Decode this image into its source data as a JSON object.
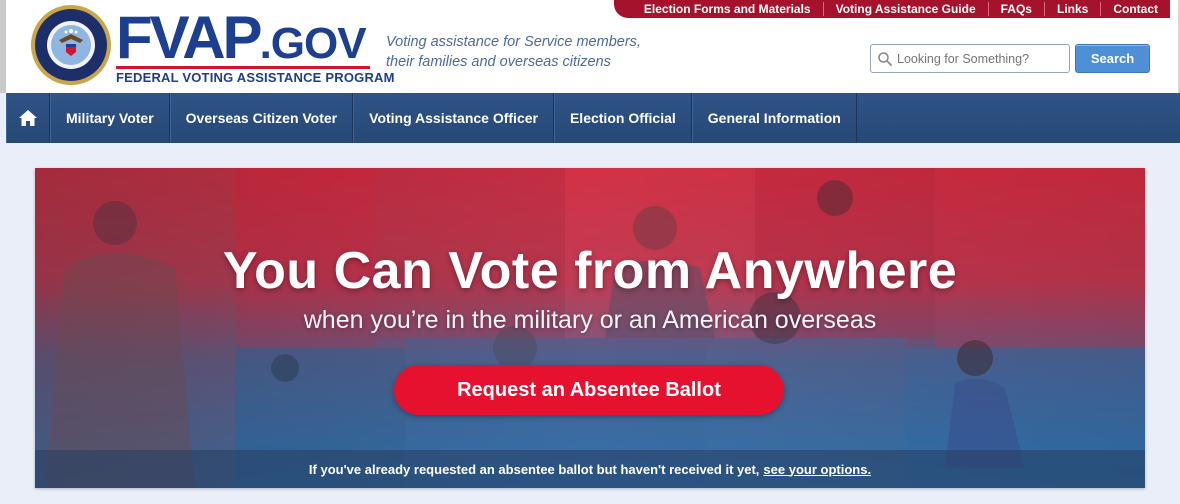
{
  "header": {
    "logo_main": "FVAP",
    "logo_gov": ".GOV",
    "logo_sub": "FEDERAL VOTING ASSISTANCE PROGRAM",
    "seal_alt": "DEPARTMENT OF DEFENSE",
    "tagline_line1": "Voting assistance for Service members,",
    "tagline_line2": "their families and overseas citizens"
  },
  "utility_links": [
    "Election Forms and Materials",
    "Voting Assistance Guide",
    "FAQs",
    "Links",
    "Contact"
  ],
  "search": {
    "placeholder": "Looking for Something?",
    "button_label": "Search"
  },
  "nav": {
    "home_icon": "home-icon",
    "items": [
      "Military Voter",
      "Overseas Citizen Voter",
      "Voting Assistance Officer",
      "Election Official",
      "General Information"
    ]
  },
  "hero": {
    "title": "You Can Vote from Anywhere",
    "subtitle": "when you’re in the military or an American overseas",
    "cta_label": "Request an Absentee Ballot",
    "bar_text": "If you've already requested an absentee ballot but haven't received it yet,",
    "bar_link": "see your options."
  },
  "colors": {
    "brand_blue": "#1d3f8f",
    "brand_red": "#d2152b",
    "utility_bar": "#a5122b",
    "nav_blue": "#2f5486",
    "cta_red": "#e6112f",
    "search_button": "#4f8fd6"
  }
}
